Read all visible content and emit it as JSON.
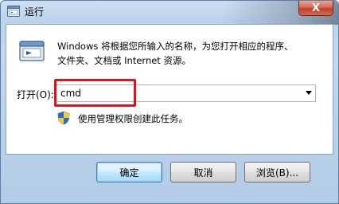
{
  "window": {
    "title": "运行",
    "close_label": "X"
  },
  "dialog": {
    "description_line1": "Windows 将根据您所输入的名称，为您打开相应的程序、",
    "description_line2": "文件夹、文档或 Internet 资源。",
    "open_label": "打开(O):",
    "open_value": "cmd",
    "admin_note": "使用管理权限创建此任务。"
  },
  "buttons": {
    "ok": "确定",
    "cancel": "取消",
    "browse": "浏览(B)..."
  },
  "icons": {
    "title": "run-icon",
    "main": "run-icon",
    "shield": "uac-shield-icon",
    "close": "close-icon",
    "dropdown": "chevron-down-icon"
  },
  "colors": {
    "highlight": "#e0121b",
    "close_button": "#c3412a"
  }
}
